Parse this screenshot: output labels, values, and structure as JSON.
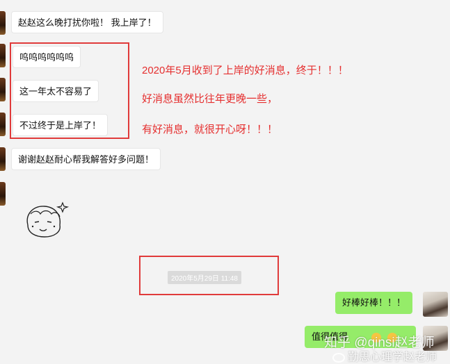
{
  "messages_left": [
    {
      "text": "赵赵这么晚打扰你啦！ 我上岸了！"
    },
    {
      "text": "呜呜呜呜呜呜"
    },
    {
      "text": "这一年太不容易了"
    },
    {
      "text": "不过终于是上岸了！"
    },
    {
      "text": "谢谢赵赵耐心帮我解答好多问题！"
    }
  ],
  "annotations": [
    "2020年5月收到了上岸的好消息，终于！！！",
    "好消息虽然比往年更晚一些，",
    "有好消息，就很开心呀！！！"
  ],
  "timestamp": "2020年5月29日 11:48",
  "messages_right": [
    {
      "text": "好棒好棒！！！"
    },
    {
      "text": "值得值得"
    }
  ],
  "sticker": "cartoon-girl-sticker",
  "watermark": {
    "line1": "知乎 @qinsi赵老师",
    "line2": "勤思心理学赵老师"
  }
}
